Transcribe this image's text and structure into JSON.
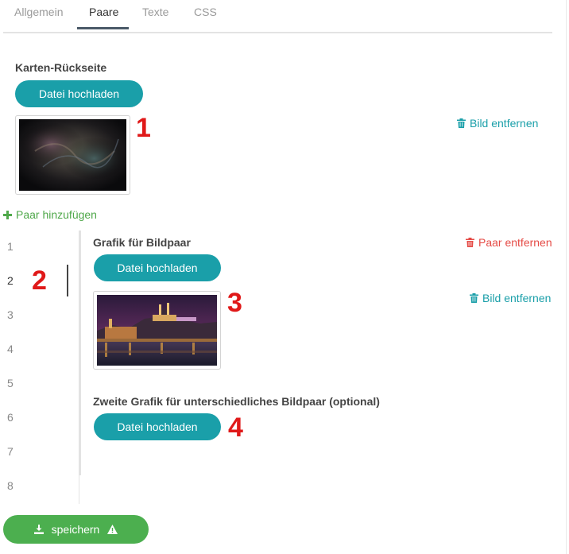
{
  "tabs": [
    {
      "label": "Allgemein",
      "active": false
    },
    {
      "label": "Paare",
      "active": true
    },
    {
      "label": "Texte",
      "active": false
    },
    {
      "label": "CSS",
      "active": false
    }
  ],
  "card_back": {
    "title": "Karten-Rückseite",
    "upload_label": "Datei hochladen",
    "remove_label": "Bild entfernen",
    "annotation": "1"
  },
  "add_pair_label": "Paar hinzufügen",
  "pair_numbers": [
    "1",
    "2",
    "3",
    "4",
    "5",
    "6",
    "7",
    "8"
  ],
  "selected_pair": "2",
  "selected_annotation": "2",
  "pair": {
    "title": "Grafik für Bildpaar",
    "remove_pair_label": "Paar entfernen",
    "upload_label": "Datei hochladen",
    "remove_image_label": "Bild entfernen",
    "image_annotation": "3",
    "second_title": "Zweite Grafik für unterschiedliches Bildpaar (optional)",
    "second_upload_label": "Datei hochladen",
    "second_annotation": "4"
  },
  "save_label": "speichern",
  "colors": {
    "teal": "#1a9fa9",
    "green": "#4caf4f",
    "red": "#e54b46",
    "annotation_red": "#e01919"
  }
}
